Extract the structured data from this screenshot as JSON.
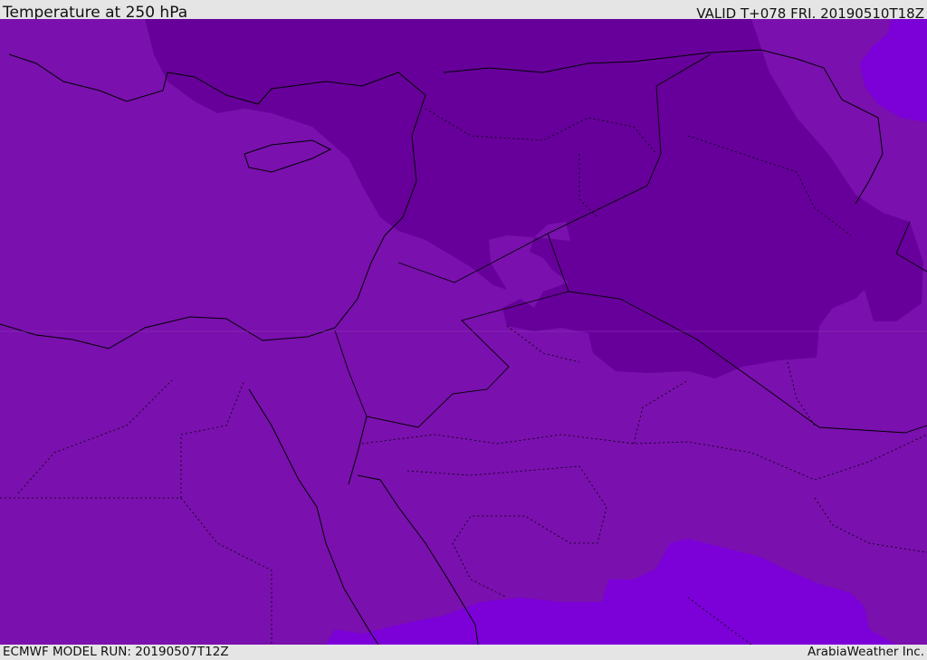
{
  "header": {
    "title": "Temperature at 250 hPa",
    "valid": "VALID T+078 FRI. 20190510T18Z"
  },
  "footer": {
    "model_run": "ECMWF MODEL RUN: 20190507T12Z",
    "credit": "ArabiaWeather Inc."
  },
  "colors": {
    "base": "#7a10ae",
    "cold": "#67009a",
    "warm": "#7c00d8",
    "lines": "#000000"
  }
}
